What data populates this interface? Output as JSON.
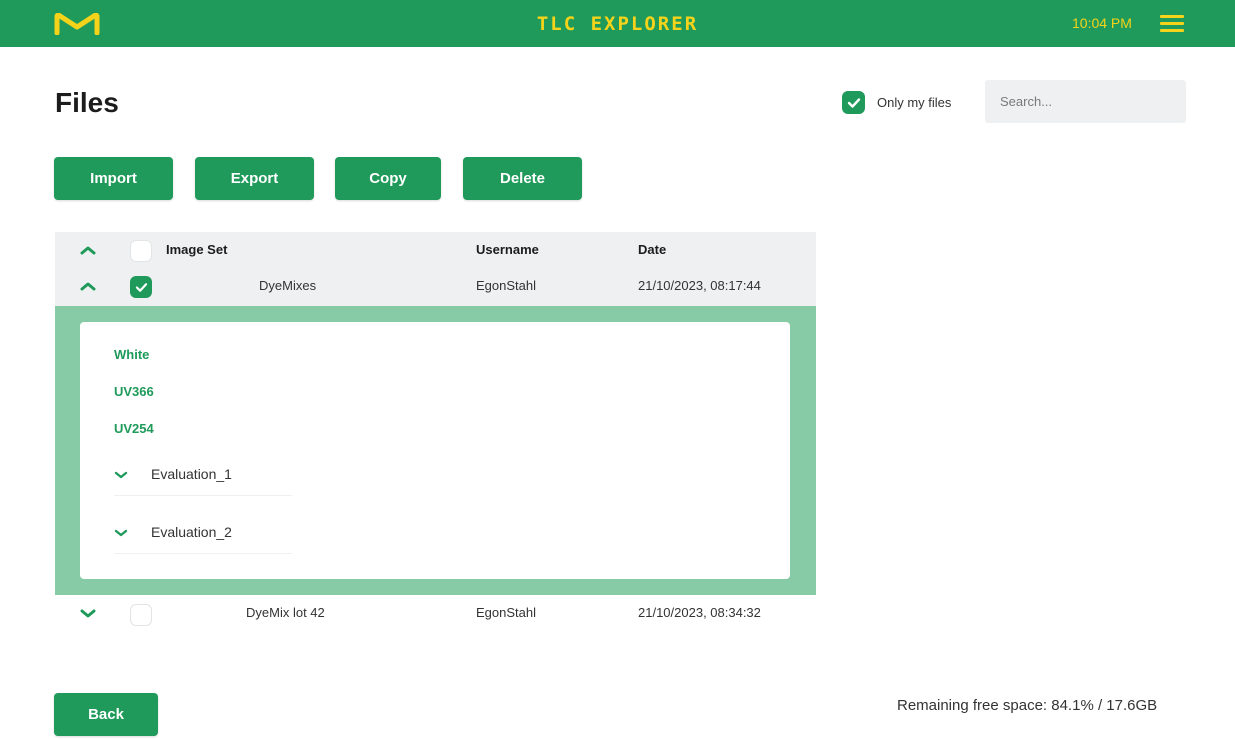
{
  "header": {
    "app_title": "TLC EXPLORER",
    "time": "10:04 PM",
    "logo_icon": "m-logo-icon",
    "menu_icon": "hamburger-menu-icon",
    "brand_color": "#1f9a5b",
    "accent_color": "#f4d31a"
  },
  "page": {
    "title": "Files"
  },
  "filter": {
    "only_my_files_label": "Only my files",
    "only_my_files_checked": true,
    "search_placeholder": "Search..."
  },
  "toolbar": {
    "import_label": "Import",
    "export_label": "Export",
    "copy_label": "Copy",
    "delete_label": "Delete"
  },
  "table": {
    "columns": [
      "Image Set",
      "Username",
      "Date"
    ],
    "rows": [
      {
        "name": "DyeMixes",
        "username": "EgonStahl",
        "date": "21/10/2023, 08:17:44",
        "checked": true,
        "expanded": true,
        "children": {
          "images": [
            "White",
            "UV366",
            "UV254"
          ],
          "evaluations": [
            "Evaluation_1",
            "Evaluation_2"
          ]
        }
      },
      {
        "name": "DyeMix lot 42",
        "username": "EgonStahl",
        "date": "21/10/2023, 08:34:32",
        "checked": false,
        "expanded": false
      }
    ]
  },
  "footer": {
    "back_label": "Back",
    "free_space": "Remaining free space: 84.1% / 17.6GB"
  }
}
